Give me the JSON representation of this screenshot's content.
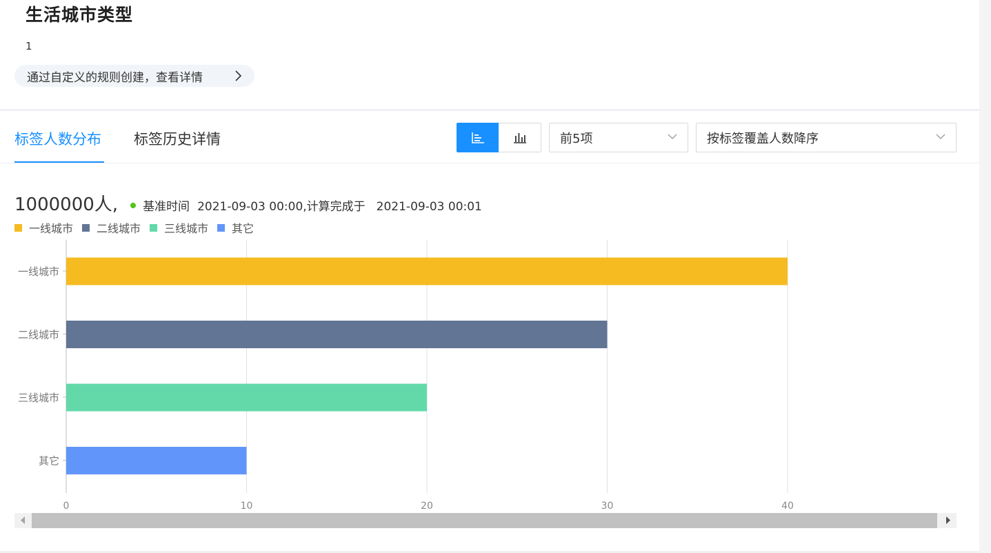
{
  "header": {
    "title": "生活城市类型",
    "subtitle": "1",
    "rule_link": "通过自定义的规则创建，查看详情"
  },
  "tabs": [
    {
      "label": "标签人数分布",
      "active": true
    },
    {
      "label": "标签历史详情",
      "active": false
    }
  ],
  "toolbar": {
    "view_toggle_icons": [
      "horizontal-bar-chart-icon",
      "vertical-bar-chart-icon"
    ],
    "active_view": "horizontal-bar-chart-icon",
    "top_select": "前5项",
    "sort_select": "按标签覆盖人数降序"
  },
  "summary": {
    "count": "1000000人,",
    "base_time_label": "基准时间",
    "base_time": "2021-09-03 00:00,计算完成于",
    "computed_time": "2021-09-03 00:01",
    "status_color": "#52c41a"
  },
  "colors": {
    "accent": "#1890ff"
  },
  "chart_data": {
    "type": "bar",
    "orientation": "horizontal",
    "categories": [
      "一线城市",
      "二线城市",
      "三线城市",
      "其它"
    ],
    "values": [
      40,
      30,
      20,
      10
    ],
    "colors": [
      "#f5bb21",
      "#627594",
      "#63d9aa",
      "#6295f9"
    ],
    "legend": [
      "一线城市",
      "二线城市",
      "三线城市",
      "其它"
    ],
    "legend_position": "top-left",
    "xlim": [
      0,
      40
    ],
    "x_ticks": [
      "0",
      "10",
      "20",
      "30",
      "40"
    ],
    "grid": true,
    "title": "",
    "xlabel": "",
    "ylabel": ""
  }
}
